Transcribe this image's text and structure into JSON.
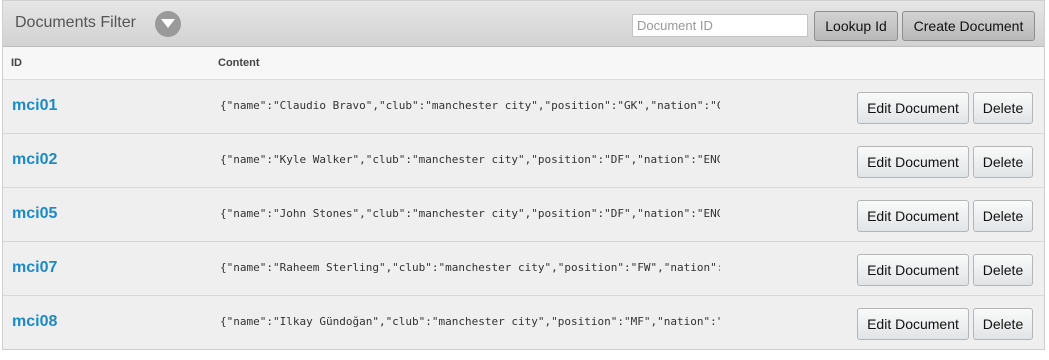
{
  "header": {
    "title": "Documents Filter",
    "filter_toggle_icon": "chevron-down-icon",
    "docid_placeholder": "Document ID",
    "lookup_label": "Lookup Id",
    "create_label": "Create Document"
  },
  "columns": {
    "id": "ID",
    "content": "Content"
  },
  "rows": [
    {
      "id": "mci01",
      "content": "{\"name\":\"Claudio Bravo\",\"club\":\"manchester city\",\"position\":\"GK\",\"nation\":\"CHILE\"...",
      "edit_label": "Edit Document",
      "delete_label": "Delete"
    },
    {
      "id": "mci02",
      "content": "{\"name\":\"Kyle Walker\",\"club\":\"manchester city\",\"position\":\"DF\",\"nation\":\"ENGLAND\"...",
      "edit_label": "Edit Document",
      "delete_label": "Delete"
    },
    {
      "id": "mci05",
      "content": "{\"name\":\"John Stones\",\"club\":\"manchester city\",\"position\":\"DF\",\"nation\":\"ENGLAND\"...",
      "edit_label": "Edit Document",
      "delete_label": "Delete"
    },
    {
      "id": "mci07",
      "content": "{\"name\":\"Raheem Sterling\",\"club\":\"manchester city\",\"position\":\"FW\",\"nation\":\"ENGL...",
      "edit_label": "Edit Document",
      "delete_label": "Delete"
    },
    {
      "id": "mci08",
      "content": "{\"name\":\"Ilkay Gündoğan\",\"club\":\"manchester city\",\"position\":\"MF\",\"nation\":\"GERMA...",
      "edit_label": "Edit Document",
      "delete_label": "Delete"
    }
  ],
  "colors": {
    "link": "#1a8bc8",
    "header_bg": "#d9d9d9",
    "row_bg": "#efefef"
  }
}
